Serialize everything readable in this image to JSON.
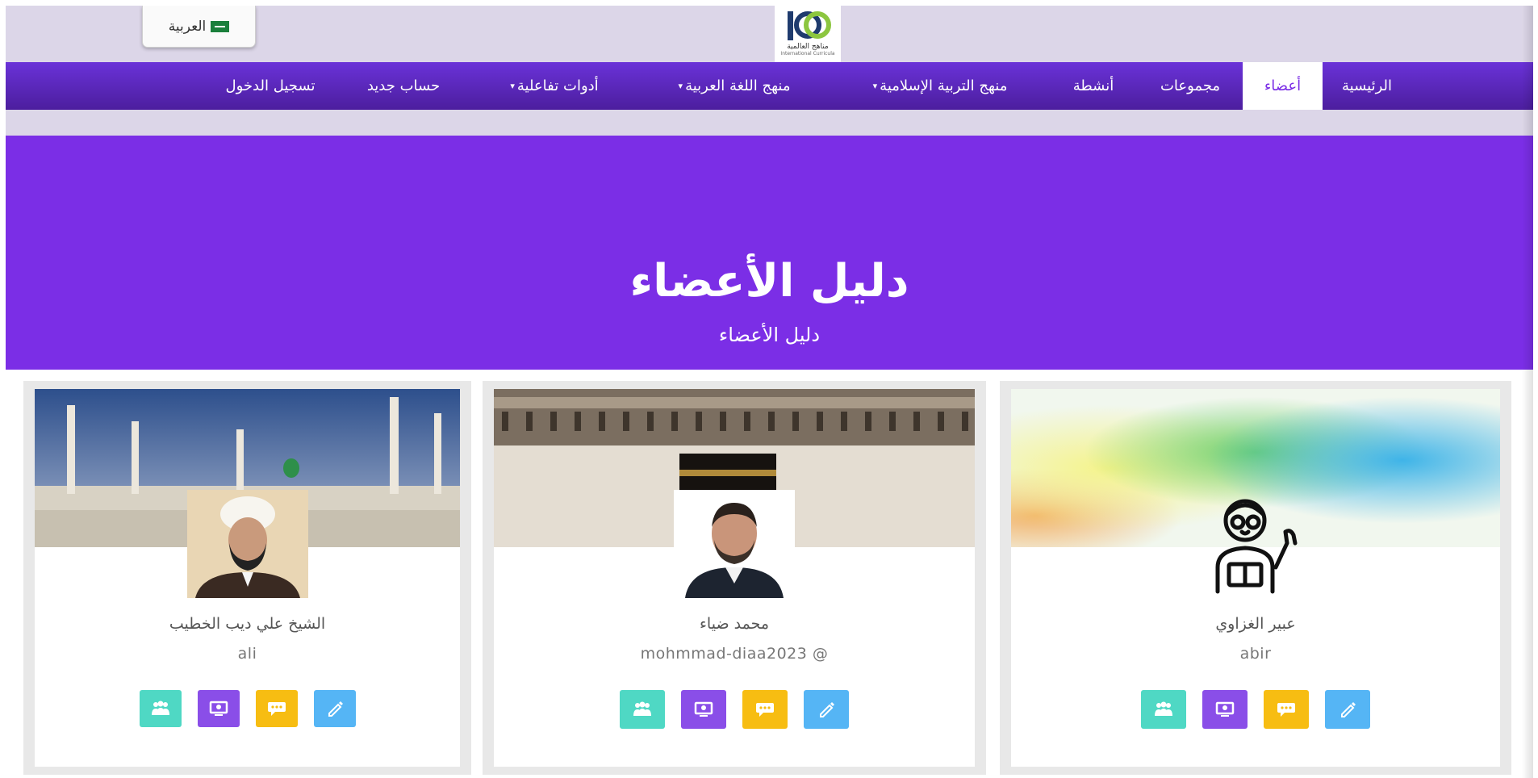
{
  "language_button": {
    "label": "العربية",
    "icon": "saudi-flag-icon"
  },
  "logo": {
    "mark": "ICO",
    "text_ar": "مناهج العالمية",
    "text_en": "International Curricula"
  },
  "nav": {
    "home": "الرئيسية",
    "members": "أعضاء",
    "groups": "مجموعات",
    "activities": "أنشطة",
    "islamic": "منهج التربية الإسلامية",
    "arabic": "منهج اللغة العربية",
    "tools": "أدوات تفاعلية",
    "register": "حساب جديد",
    "login": "تسجيل الدخول",
    "dropdown_caret": "▾"
  },
  "hero": {
    "title": "دليل الأعضاء",
    "subtitle": "دليل الأعضاء"
  },
  "members": [
    {
      "name": "عبير الغزاوي",
      "handle": "abir",
      "cover": "colorful-smoke",
      "avatar": "teacher-line-icon"
    },
    {
      "name": "محمد ضياء",
      "handle": "mohmmad-diaa2023 @",
      "cover": "kaaba-mecca",
      "avatar": "man-photo"
    },
    {
      "name": "الشيخ علي ديب الخطيب",
      "handle": "ali",
      "cover": "prophets-mosque",
      "avatar": "sheikh-photo"
    }
  ],
  "action_icons": [
    "group-icon",
    "profile-view-icon",
    "message-icon",
    "edit-icon"
  ],
  "colors": {
    "purple": "#7b2ee6",
    "nav_dark": "#4c1e9e",
    "teal": "#4fd8c4",
    "violet": "#8a4ee8",
    "yellow": "#f7bd12",
    "blue": "#55b5f5",
    "topbar": "#dcd6e8"
  }
}
